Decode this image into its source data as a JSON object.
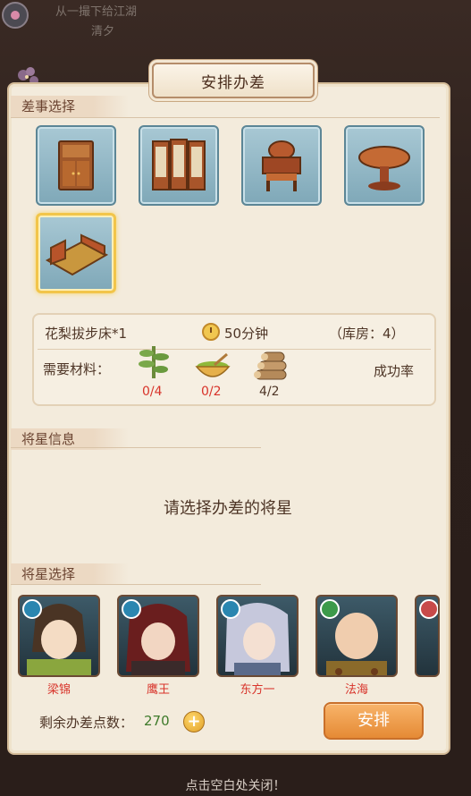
{
  "background": {
    "text_line_1": "从一撮下给江湖",
    "text_line_2": "清夕"
  },
  "dialog": {
    "title": "安排办差"
  },
  "task_section": {
    "title": "差事选择",
    "items": [
      {
        "name": "cabinet",
        "icon": "cabinet-icon"
      },
      {
        "name": "folding-screen",
        "icon": "folding-screen-icon"
      },
      {
        "name": "armchair",
        "icon": "armchair-icon"
      },
      {
        "name": "round-table",
        "icon": "round-table-icon"
      },
      {
        "name": "bed",
        "icon": "bed-icon",
        "selected": true
      }
    ]
  },
  "task_info": {
    "item_name": "花梨拔步床*1",
    "duration": "50分钟",
    "storage": "（库房：4）",
    "materials_label": "需要材料：",
    "materials": [
      {
        "icon": "bamboo-icon",
        "count": "0/4",
        "color": "#d8332a"
      },
      {
        "icon": "herb-bowl-icon",
        "count": "0/2",
        "color": "#d8332a"
      },
      {
        "icon": "wood-logs-icon",
        "count": "4/2",
        "color": "#4e3526"
      }
    ],
    "success_rate_label": "成功率"
  },
  "general_info": {
    "title": "将星信息",
    "placeholder": "请选择办差的将星"
  },
  "general_select": {
    "title": "将星选择",
    "heroes": [
      {
        "name": "梁锦",
        "badge_color": "#2a86b0"
      },
      {
        "name": "鹰王",
        "badge_color": "#2a86b0"
      },
      {
        "name": "东方一",
        "badge_color": "#2a86b0"
      },
      {
        "name": "法海",
        "badge_color": "#3c9a4a"
      }
    ]
  },
  "footer": {
    "points_label": "剩余办差点数：",
    "points_value": "270",
    "add_symbol": "+",
    "arrange_button": "安排",
    "close_hint": "点击空白处关闭！"
  },
  "colors": {
    "panel_bg": "#f3ebdc",
    "accent_orange": "#e58a35",
    "shortage_red": "#d8332a",
    "selected_gold": "#f2c54a"
  }
}
